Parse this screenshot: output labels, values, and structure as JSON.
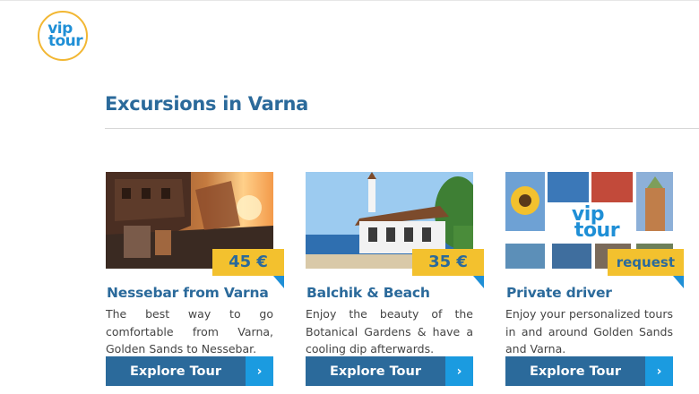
{
  "logo": {
    "line1": "vip",
    "line2": "tour"
  },
  "section": {
    "title": "Excursions in Varna"
  },
  "colors": {
    "brand_blue": "#2b6a9b",
    "accent_blue": "#1b9be0",
    "badge_yellow": "#f3c12e"
  },
  "cards": [
    {
      "title": "Nessebar from Varna",
      "price": "45 €",
      "description": "The best way to go comfortable from Varna, Golden Sands to Nessebar.",
      "button": "Explore Tour",
      "arrow": "›",
      "image_icon": "old-town-street-photo"
    },
    {
      "title": "Balchik & Beach",
      "price": "35 €",
      "description": "Enjoy the beauty of the Botanical Gardens & have a cooling dip afterwards.",
      "button": "Explore Tour",
      "arrow": "›",
      "image_icon": "palace-photo"
    },
    {
      "title": "Private driver",
      "price": "request",
      "description": "Enjoy your personalized tours in and around Golden Sands and Varna.",
      "button": "Explore Tour",
      "arrow": "›",
      "image_icon": "collage-photo",
      "image_logo": {
        "line1": "vip",
        "line2": "tour"
      }
    }
  ]
}
